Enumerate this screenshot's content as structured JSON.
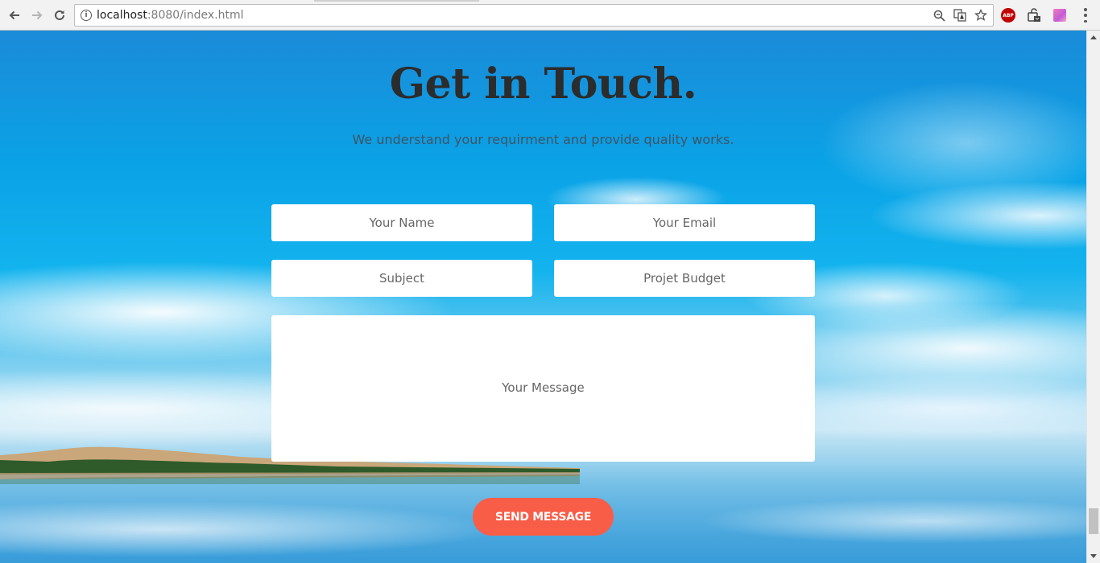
{
  "browser": {
    "url_host": "localhost",
    "url_rest": ":8080/index.html",
    "back_icon": "arrow-left-icon",
    "forward_icon": "arrow-right-icon",
    "reload_icon": "reload-icon",
    "info_icon": "info-icon",
    "info_glyph": "i",
    "zoom_icon": "zoom-icon",
    "translate_icon": "translate-icon",
    "bookmark_icon": "star-icon",
    "extension_abp": "ABP",
    "menu_icon": "more-vert-icon"
  },
  "contact": {
    "title": "Get in Touch.",
    "subtitle": "We understand your requirment and provide quality works.",
    "fields": {
      "name_placeholder": "Your Name",
      "email_placeholder": "Your Email",
      "subject_placeholder": "Subject",
      "budget_placeholder": "Projet Budget",
      "message_placeholder": "Your Message"
    },
    "send_label": "SEND MESSAGE"
  },
  "colors": {
    "button": "#f85d48",
    "title": "#2c2c2c",
    "sky": "#13b3ee"
  }
}
